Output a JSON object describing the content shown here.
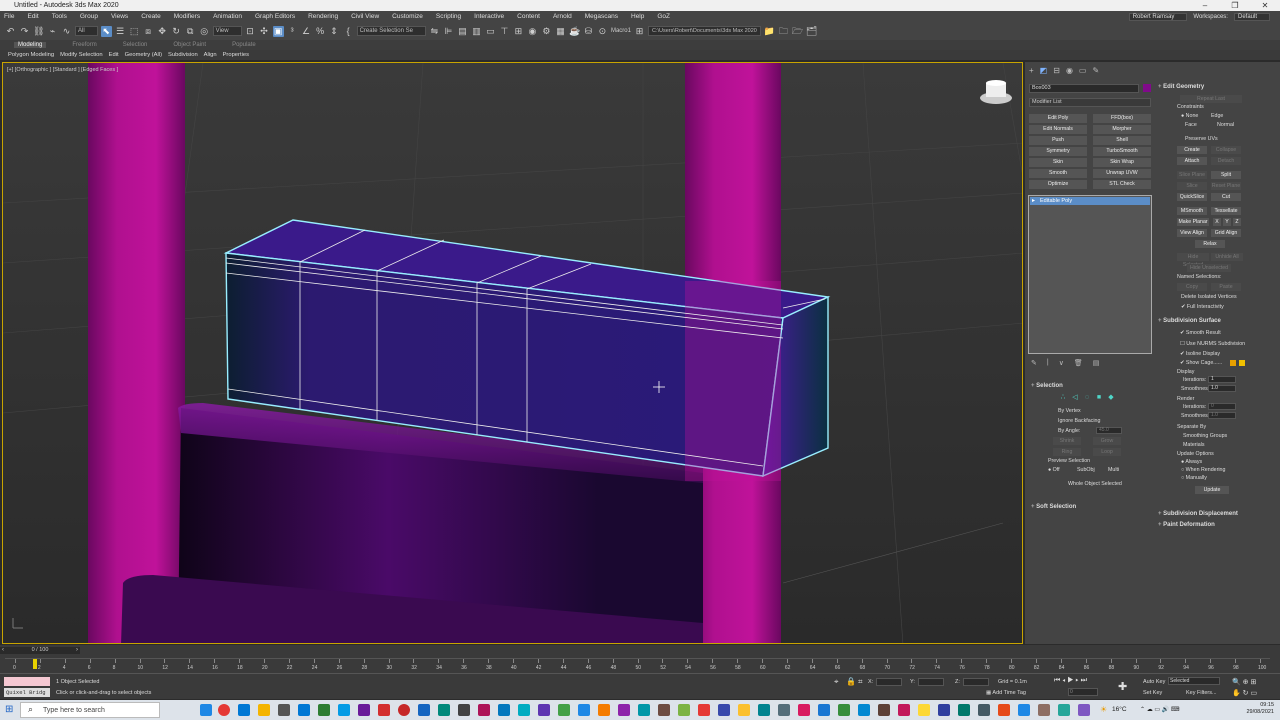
{
  "window": {
    "title": "Untitled - Autodesk 3ds Max 2020",
    "controls": [
      "–",
      "❐",
      "✕"
    ]
  },
  "menu": {
    "items": [
      "File",
      "Edit",
      "Tools",
      "Group",
      "Views",
      "Create",
      "Modifiers",
      "Animation",
      "Graph Editors",
      "Rendering",
      "Civil View",
      "Customize",
      "Scripting",
      "Interactive",
      "Content",
      "Arnold",
      "Megascans",
      "Help",
      "GoZ"
    ],
    "user": "Robert Ramsay",
    "workspaces_label": "Workspaces:",
    "workspace": "Default"
  },
  "toolbar": {
    "filter": "All",
    "ref_coord": "View",
    "selection_set": "Create Selection Se",
    "macro": "Macro1",
    "path": "C:\\Users\\Robert\\Documents\\3ds Max 2020"
  },
  "ribbon": {
    "tabs": [
      "Modeling",
      "Freeform",
      "Selection",
      "Object Paint",
      "Populate"
    ],
    "active_tab": "Modeling",
    "subtabs": [
      "Polygon Modeling",
      "Modify Selection",
      "Edit",
      "Geometry (All)",
      "Subdivision",
      "Align",
      "Properties"
    ]
  },
  "viewport": {
    "label": "[+] [Orthographic ] [Standard ] [Edged Faces ]"
  },
  "command_panel": {
    "object_name": "Box003",
    "object_color": "#800a8a",
    "modifier_list": "Modifier List",
    "modifier_buttons": [
      "Edit Poly",
      "FFD(box)",
      "Edit Normals",
      "Morpher",
      "Push",
      "Shell",
      "Symmetry",
      "TurboSmooth",
      "Skin",
      "Skin Wrap",
      "Smooth",
      "Unwrap UVW",
      "Optimize",
      "STL Check"
    ],
    "stack_item": "Editable Poly",
    "selection": {
      "title": "Selection",
      "by_vertex": "By Vertex",
      "ignore_backfacing": "Ignore Backfacing",
      "by_angle": "By Angle:",
      "by_angle_value": "45.0",
      "shrink": "Shrink",
      "grow": "Grow",
      "ring": "Ring",
      "loop": "Loop",
      "preview_selection": "Preview Selection",
      "off": "Off",
      "subobj": "SubObj",
      "multi": "Multi",
      "status": "Whole Object Selected"
    },
    "soft_selection": "Soft Selection",
    "edit_geometry": {
      "title": "Edit Geometry",
      "repeat_last": "Repeat Last",
      "constraints": "Constraints",
      "none": "None",
      "edge": "Edge",
      "face": "Face",
      "normal": "Normal",
      "preserve_uvs": "Preserve UVs",
      "create": "Create",
      "collapse": "Collapse",
      "attach": "Attach",
      "detach": "Detach",
      "slice_plane": "Slice Plane",
      "split": "Split",
      "slice": "Slice",
      "reset_plane": "Reset Plane",
      "quickslice": "QuickSlice",
      "cut": "Cut",
      "msmooth": "MSmooth",
      "tessellate": "Tessellate",
      "make_planar": "Make Planar",
      "x": "X",
      "y": "Y",
      "z": "Z",
      "view_align": "View Align",
      "grid_align": "Grid Align",
      "relax": "Relax",
      "hide_selected": "Hide Selected",
      "unhide_all": "Unhide All",
      "hide_unselected": "Hide Unselected",
      "named_selections": "Named Selections:",
      "copy": "Copy",
      "paste": "Paste",
      "delete_isolated": "Delete Isolated Vertices",
      "full_interactivity": "Full Interactivity"
    },
    "subdivision_surface": {
      "title": "Subdivision Surface",
      "smooth_result": "Smooth Result",
      "use_nurms": "Use NURMS Subdivision",
      "isoline_display": "Isoline Display",
      "show_cage": "Show Cage......",
      "display": "Display",
      "iterations": "Iterations:",
      "iterations_value": "1",
      "smoothness": "Smoothness:",
      "smoothness_value": "1.0",
      "render": "Render",
      "r_iterations_value": "0",
      "r_smoothness_value": "1.0",
      "separate_by": "Separate By",
      "smoothing_groups": "Smoothing Groups",
      "materials": "Materials",
      "update_options": "Update Options",
      "always": "Always",
      "when_rendering": "When Rendering",
      "manually": "Manually",
      "update": "Update"
    },
    "subdivision_displacement": "Subdivision Displacement",
    "paint_deformation": "Paint Deformation"
  },
  "timeline": {
    "slider": "0 / 100",
    "ticks": [
      "0",
      "2",
      "4",
      "6",
      "8",
      "10",
      "12",
      "14",
      "16",
      "18",
      "20",
      "22",
      "24",
      "26",
      "28",
      "30",
      "32",
      "34",
      "36",
      "38",
      "40",
      "42",
      "44",
      "46",
      "48",
      "50",
      "52",
      "54",
      "56",
      "58",
      "60",
      "62",
      "64",
      "66",
      "68",
      "70",
      "72",
      "74",
      "76",
      "78",
      "80",
      "82",
      "84",
      "86",
      "88",
      "90",
      "92",
      "94",
      "96",
      "98",
      "100"
    ]
  },
  "status": {
    "script_text": "Quixel Bridg",
    "objects_selected": "1 Object Selected",
    "prompt": "Click or click-and-drag to select objects",
    "x_label": "X:",
    "y_label": "Y:",
    "z_label": "Z:",
    "grid": "Grid = 0.1m",
    "add_time_tag": "Add Time Tag",
    "auto_key": "Auto Key",
    "set_key": "Set Key",
    "selected": "Selected",
    "key_filters": "Key Filters...",
    "frame": "0"
  },
  "taskbar": {
    "search_placeholder": "Type here to search",
    "temperature": "16°C",
    "time": "09:15",
    "date": "29/08/2021"
  }
}
